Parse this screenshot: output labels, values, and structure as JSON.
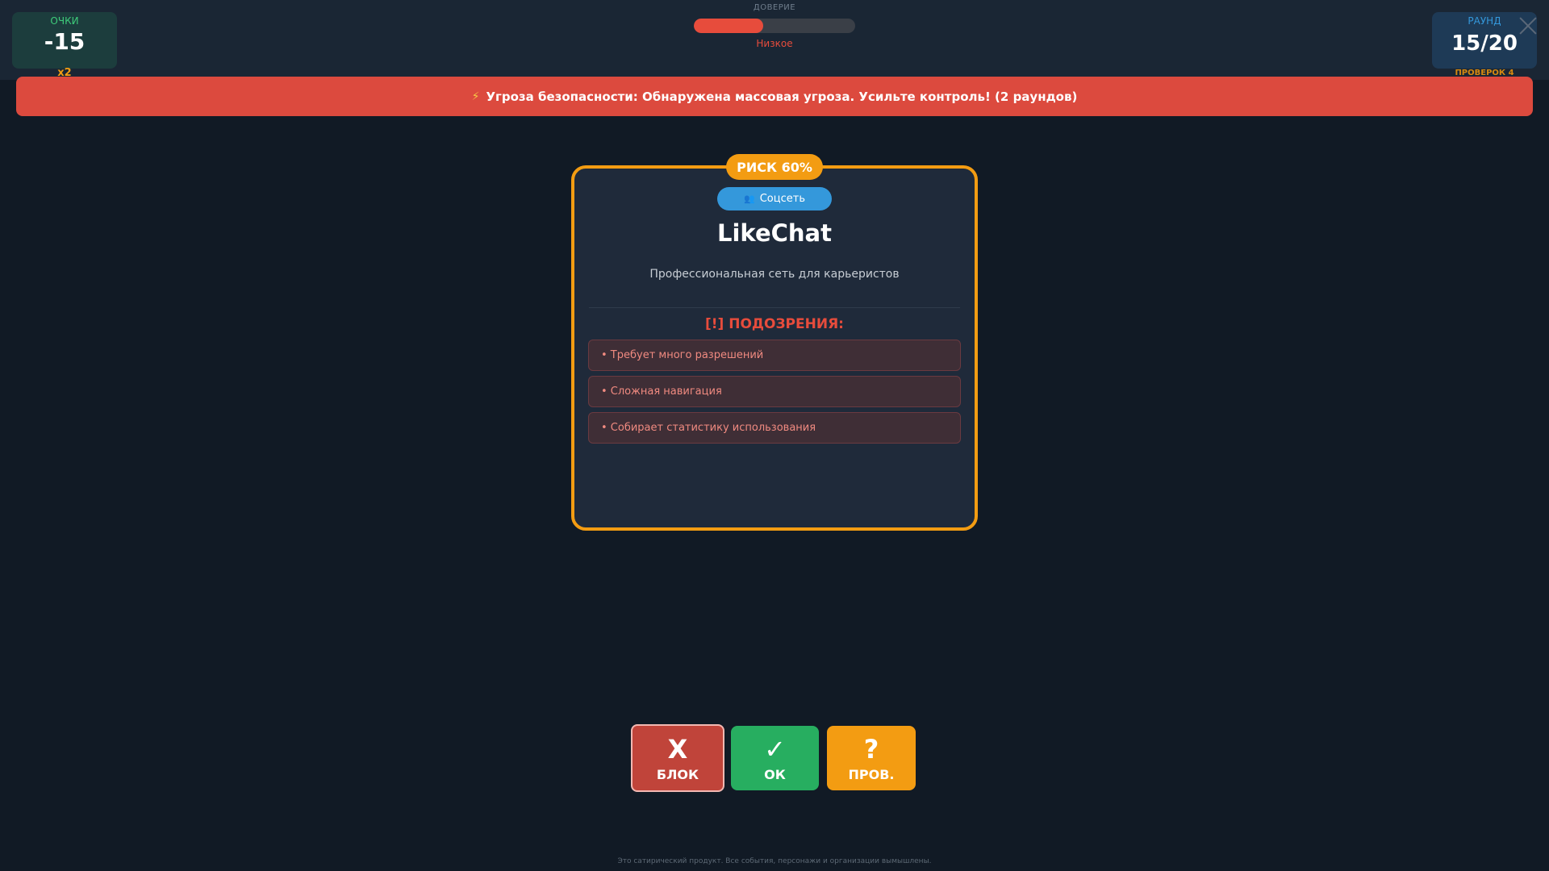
{
  "score": {
    "label": "ОЧКИ",
    "value": "-15",
    "multiplier": "x2"
  },
  "round": {
    "label": "РАУНД",
    "value": "15/20",
    "checks": "ПРОВЕРОК 4"
  },
  "trust": {
    "label": "ДОВЕРИЕ",
    "level": "Низкое",
    "fill_percent": 43
  },
  "alert": {
    "icon": "lightning-icon",
    "text": "Угроза безопасности: Обнаружена массовая угроза. Усильте контроль! (2 раундов)"
  },
  "card": {
    "risk": "РИСК 60%",
    "category_icon": "people-icon",
    "category": "Соцсеть",
    "app_name": "LikeChat",
    "description": "Профессиональная сеть для карьеристов",
    "suspicions_title": "[!] ПОДОЗРЕНИЯ:",
    "suspicions": [
      "• Требует много разрешений",
      "• Сложная навигация",
      "• Собирает статистику использования"
    ]
  },
  "actions": {
    "block": {
      "glyph": "X",
      "label": "БЛОК"
    },
    "ok": {
      "glyph": "✓",
      "label": "ОК"
    },
    "check": {
      "glyph": "?",
      "label": "ПРОВ."
    }
  },
  "footer": "Это сатирический продукт. Все события, персонажи и организации вымышлены.",
  "colors": {
    "background": "#111a25",
    "danger": "#e74c3c",
    "success": "#27ae60",
    "warning": "#f39c12",
    "info": "#3498db"
  }
}
